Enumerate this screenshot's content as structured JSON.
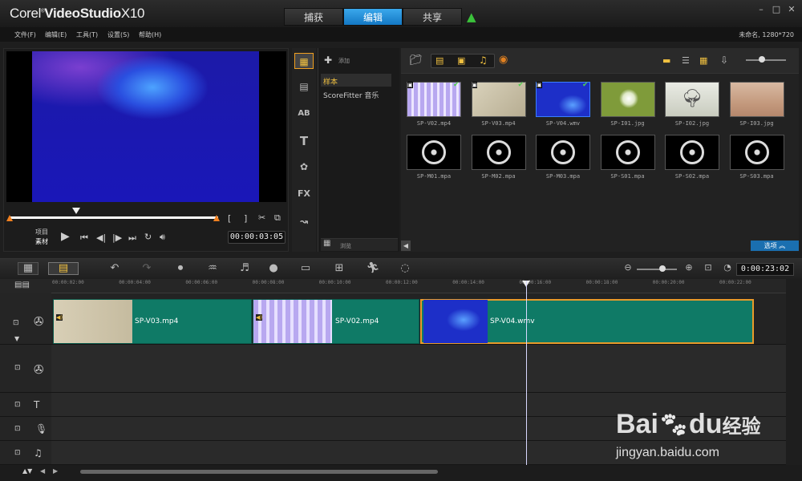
{
  "app": {
    "logo_main": "Corel",
    "logo_product": "VideoStudio",
    "logo_version": "X10"
  },
  "tabs": [
    {
      "label": "捕获"
    },
    {
      "label": "编辑"
    },
    {
      "label": "共享"
    }
  ],
  "menu": [
    "文件(F)",
    "编辑(E)",
    "工具(T)",
    "设置(S)",
    "帮助(H)"
  ],
  "project_info": "未命名, 1280*720",
  "preview": {
    "mode_top": "项目",
    "mode_bottom": "素材",
    "timecode": "00:00:03:05"
  },
  "library": {
    "add_label": "添加",
    "folders": [
      "样本",
      "ScoreFitter 音乐"
    ],
    "browse_label": "浏览",
    "options_label": "选项",
    "items": [
      {
        "name": "SP-V02.mp4",
        "kind": "video-pixels",
        "checked": true
      },
      {
        "name": "SP-V03.mp4",
        "kind": "video-beige",
        "checked": true
      },
      {
        "name": "SP-V04.wmv",
        "kind": "video-blue",
        "checked": true
      },
      {
        "name": "SP-I01.jpg",
        "kind": "dandelion",
        "checked": false
      },
      {
        "name": "SP-I02.jpg",
        "kind": "tree",
        "checked": false
      },
      {
        "name": "SP-I03.jpg",
        "kind": "desert",
        "checked": false
      },
      {
        "name": "SP-M01.mpa",
        "kind": "audio",
        "checked": false
      },
      {
        "name": "SP-M02.mpa",
        "kind": "audio",
        "checked": false
      },
      {
        "name": "SP-M03.mpa",
        "kind": "audio",
        "checked": false
      },
      {
        "name": "SP-S01.mpa",
        "kind": "audio",
        "checked": false
      },
      {
        "name": "SP-S02.mpa",
        "kind": "audio",
        "checked": false
      },
      {
        "name": "SP-S03.mpa",
        "kind": "audio",
        "checked": false
      }
    ]
  },
  "timeline": {
    "timecode": "0:00:23:02",
    "ruler": [
      "00:00:02:00",
      "00:00:04:00",
      "00:00:06:00",
      "00:00:08:00",
      "00:00:10:00",
      "00:00:12:00",
      "00:00:14:00",
      "00:00:16:00",
      "00:00:18:00",
      "00:00:20:00",
      "00:00:22:00"
    ],
    "clips": [
      "SP-V03.mp4",
      "SP-V02.mp4",
      "SP-V04.wmv"
    ]
  },
  "watermark": {
    "brand": "Bai",
    "brand2": "du",
    "cn": "经验",
    "url": "jingyan.baidu.com"
  }
}
